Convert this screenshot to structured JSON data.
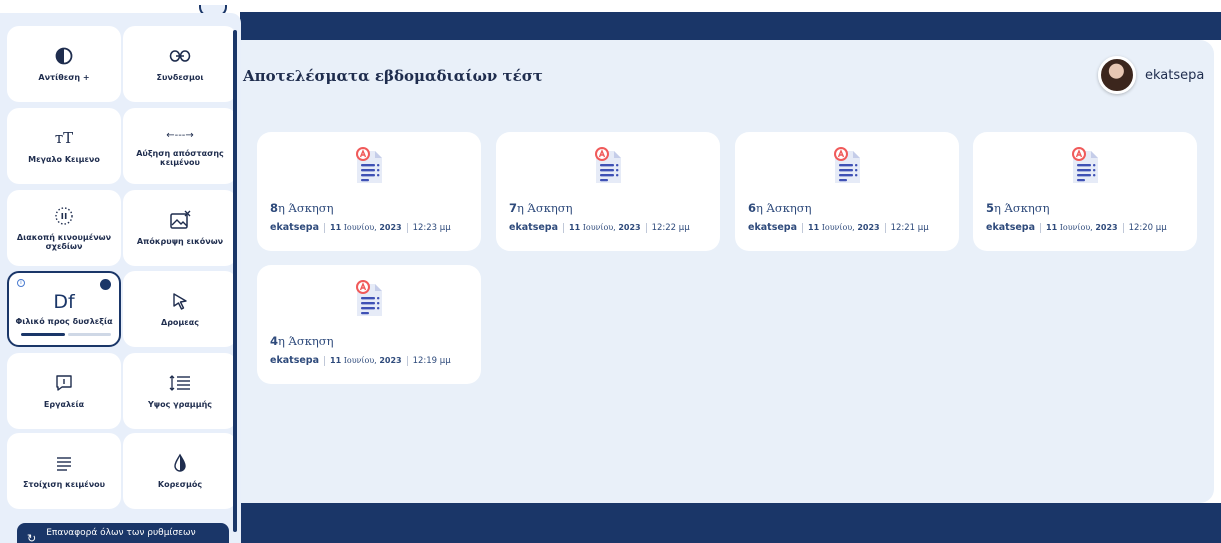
{
  "page": {
    "title": "Αποτελέσματα εβδομαδιαίων τέστ",
    "user": {
      "name": "ekatsepa"
    }
  },
  "cards": [
    {
      "num": "8",
      "title_rest": "η Άσκηση",
      "author": "ekatsepa",
      "day": "11",
      "date_rest": " Ιουνίου, ",
      "year": "2023",
      "time": "12:23 μμ"
    },
    {
      "num": "7",
      "title_rest": "η Άσκηση",
      "author": "ekatsepa",
      "day": "11",
      "date_rest": " Ιουνίου, ",
      "year": "2023",
      "time": "12:22 μμ"
    },
    {
      "num": "6",
      "title_rest": "η Άσκηση",
      "author": "ekatsepa",
      "day": "11",
      "date_rest": " Ιουνίου, ",
      "year": "2023",
      "time": "12:21 μμ"
    },
    {
      "num": "5",
      "title_rest": "η Άσκηση",
      "author": "ekatsepa",
      "day": "11",
      "date_rest": " Ιουνίου, ",
      "year": "2023",
      "time": "12:20 μμ"
    },
    {
      "num": "4",
      "title_rest": "η Άσκηση",
      "author": "ekatsepa",
      "day": "11",
      "date_rest": " Ιουνίου, ",
      "year": "2023",
      "time": "12:19 μμ"
    }
  ],
  "a11y": {
    "tiles": [
      {
        "label": "Αντίθεση +",
        "icon": "contrast-icon"
      },
      {
        "label": "Συνδεσμοι",
        "icon": "link-icon"
      },
      {
        "label": "Μεγαλο Κειμενο",
        "icon": "text-size-icon"
      },
      {
        "label": "Αύξηση απόστασης κειμένου",
        "icon": "text-spacing-icon"
      },
      {
        "label": "Διακοπή κινουμένων σχεδίων",
        "icon": "pause-animations-icon"
      },
      {
        "label": "Απόκρυψη εικόνων",
        "icon": "hide-images-icon"
      },
      {
        "label": "Φιλικό προς δυσλεξία",
        "glyph": "Df",
        "icon": "dyslexia-icon",
        "active": true,
        "level": 0.5
      },
      {
        "label": "Δρομεας",
        "icon": "cursor-icon"
      },
      {
        "label": "Εργαλεία",
        "icon": "tooltip-icon"
      },
      {
        "label": "Υψος γραμμής",
        "icon": "line-height-icon"
      },
      {
        "label": "Στοίχιση κειμένου",
        "icon": "text-align-icon"
      },
      {
        "label": "Κορεσμός",
        "icon": "saturation-icon"
      }
    ],
    "reset_label": "Επαναφορά όλων των ρυθμίσεων"
  },
  "colors": {
    "navy": "#1a3668",
    "panel": "#e9f0f9",
    "card": "#ffffff",
    "doc_blue": "#3f51b5",
    "doc_red": "#f05a5a"
  }
}
